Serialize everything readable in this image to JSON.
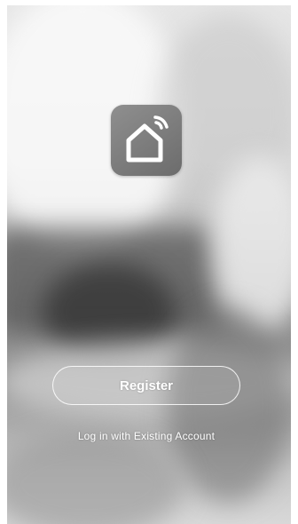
{
  "welcome": {
    "logo_icon": "smart-home-wifi-icon",
    "register_label": "Register",
    "login_label": "Log in with Existing Account"
  },
  "colors": {
    "logo_bg": "#7d7d7d",
    "button_border": "#ffffff",
    "text": "#ffffff"
  }
}
